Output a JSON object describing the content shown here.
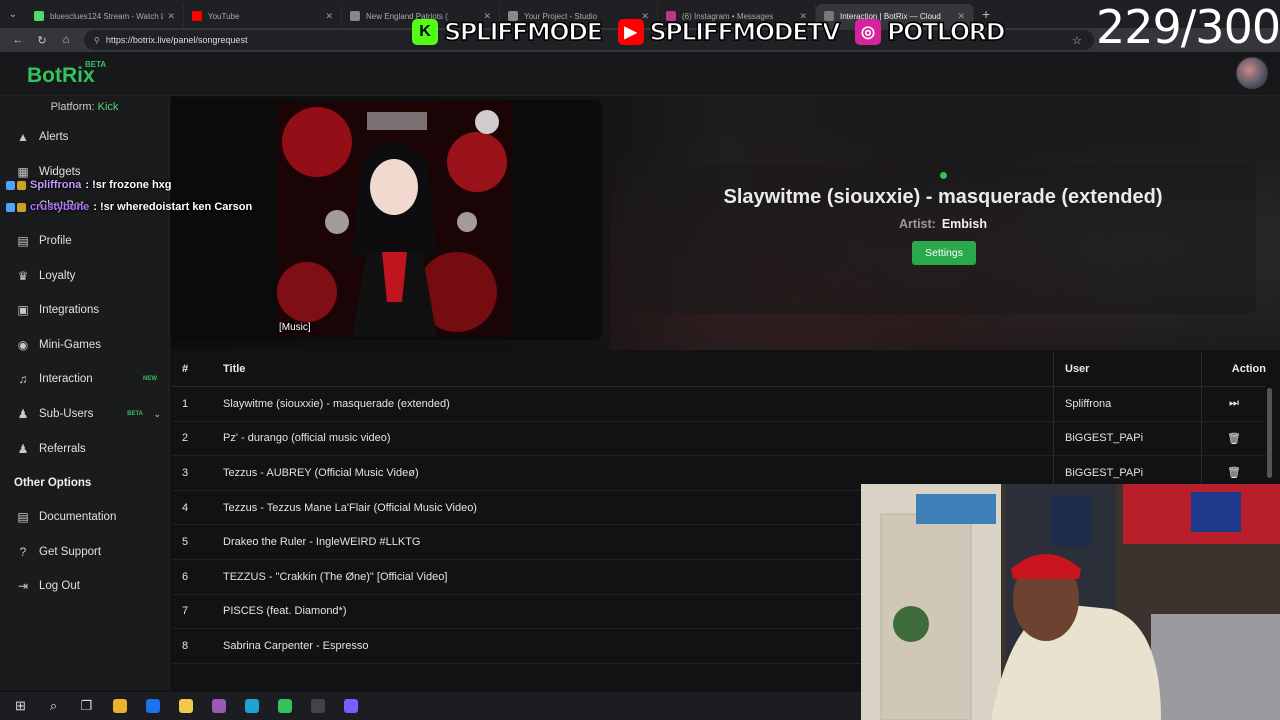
{
  "browser": {
    "tabs": [
      {
        "title": "bluesclues124 Stream - Watch Liv",
        "color": "#53d769",
        "active": false
      },
      {
        "title": "YouTube",
        "color": "#ff0000",
        "active": false
      },
      {
        "title": "New England Patriots (",
        "color": "#888888",
        "active": false
      },
      {
        "title": "Your Project - Studio",
        "color": "#888888",
        "active": false
      },
      {
        "title": "(6) Instagram • Messages",
        "color": "#c13584",
        "active": false
      },
      {
        "title": "Interaction | BotRix — Cloud",
        "color": "#777777",
        "active": true
      }
    ],
    "url": "https://botrix.live/panel/songrequest"
  },
  "overlay": {
    "counter": "229/300",
    "socials": [
      {
        "icon": "kick-icon",
        "glyph": "K",
        "bg": "#53fc18",
        "name": "SPLIFFMODE"
      },
      {
        "icon": "youtube-icon",
        "glyph": "▶",
        "bg": "#ff0000",
        "name": "SPLIFFMODETV"
      },
      {
        "icon": "instagram-icon",
        "glyph": "◎",
        "bg": "#d6249f",
        "name": "POTLORD"
      }
    ],
    "chat": [
      {
        "user": "Spliffrona",
        "message": ": !sr frozone hxg"
      },
      {
        "user": "crustybone",
        "message": ": !sr wheredoistart ken Carson"
      }
    ]
  },
  "app": {
    "logo": "BotRix",
    "logo_tag": "BETA",
    "platform_label": "Platform:",
    "platform_value": "Kick"
  },
  "sidebar": {
    "items": [
      {
        "label": "Alerts",
        "icon": "warning-icon",
        "glyph": "▲"
      },
      {
        "label": "Widgets",
        "icon": "widgets-icon",
        "glyph": "▦"
      },
      {
        "label": "Chat Bot",
        "icon": "chatbot-icon",
        "glyph": "●"
      },
      {
        "label": "Profile",
        "icon": "profile-icon",
        "glyph": "▤"
      },
      {
        "label": "Loyalty",
        "icon": "trophy-icon",
        "glyph": "♛"
      },
      {
        "label": "Integrations",
        "icon": "integrations-icon",
        "glyph": "▣"
      },
      {
        "label": "Mini-Games",
        "icon": "gamepad-icon",
        "glyph": "◉"
      },
      {
        "label": "Interaction",
        "icon": "music-icon",
        "glyph": "♫",
        "badge": "NEW"
      },
      {
        "label": "Sub-Users",
        "icon": "users-icon",
        "glyph": "♟",
        "badge": "BETA",
        "chevron": "⌄"
      },
      {
        "label": "Referrals",
        "icon": "referrals-icon",
        "glyph": "♟"
      }
    ],
    "section_title": "Other Options",
    "other": [
      {
        "label": "Documentation",
        "icon": "doc-icon",
        "glyph": "▤"
      },
      {
        "label": "Get Support",
        "icon": "help-icon",
        "glyph": "?"
      },
      {
        "label": "Log Out",
        "icon": "logout-icon",
        "glyph": "⇥"
      }
    ]
  },
  "now_playing": {
    "caption": "[Music]",
    "title": "Slaywitme (siouxxie) - masquerade (extended)",
    "artist_label": "Artist:",
    "artist": "Embish",
    "settings_label": "Settings",
    "status_color": "#2ec75a"
  },
  "queue": {
    "headers": {
      "num": "#",
      "title": "Title",
      "user": "User",
      "action": "Action"
    },
    "rows": [
      {
        "num": "1",
        "title": "Slaywitme (siouxxie) - masquerade (extended)",
        "user": "Spliffrona",
        "action": "skip-icon"
      },
      {
        "num": "2",
        "title": "Pz' - durango (official music video)",
        "user": "BiGGEST_PAPi",
        "action": "trash-icon"
      },
      {
        "num": "3",
        "title": "Tezzus - AUBREY (Official Music Videø)",
        "user": "BiGGEST_PAPi",
        "action": "trash-icon"
      },
      {
        "num": "4",
        "title": "Tezzus - Tezzus Mane La'Flair (Official Music Video)",
        "user": "",
        "action": ""
      },
      {
        "num": "5",
        "title": "Drakeo the Ruler - IngleWEIRD #LLKTG",
        "user": "",
        "action": ""
      },
      {
        "num": "6",
        "title": "TEZZUS - \"Crakkin (The Ønе)\" [Official Video]",
        "user": "",
        "action": ""
      },
      {
        "num": "7",
        "title": "PISCES (feat. Diamond*)",
        "user": "",
        "action": ""
      },
      {
        "num": "8",
        "title": "Sabrina Carpenter - Espresso",
        "user": "",
        "action": ""
      }
    ]
  },
  "taskbar": {
    "items": [
      {
        "icon": "windows-start-icon",
        "glyph": "⊞"
      },
      {
        "icon": "search-icon",
        "glyph": "⌕"
      },
      {
        "icon": "task-view-icon",
        "glyph": "❐"
      },
      {
        "icon": "file-explorer-icon",
        "color": "#e8b32a"
      },
      {
        "icon": "outlook-icon",
        "color": "#1a73e8"
      },
      {
        "icon": "store-icon",
        "color": "#f2c94c"
      },
      {
        "icon": "app-icon",
        "color": "#9b59b6"
      },
      {
        "icon": "edge-icon",
        "color": "#1fa2d6"
      },
      {
        "icon": "app-green-icon",
        "color": "#35c25c"
      },
      {
        "icon": "obs-icon",
        "color": "#444444"
      },
      {
        "icon": "app-purple-icon",
        "color": "#7b5cff"
      }
    ]
  }
}
